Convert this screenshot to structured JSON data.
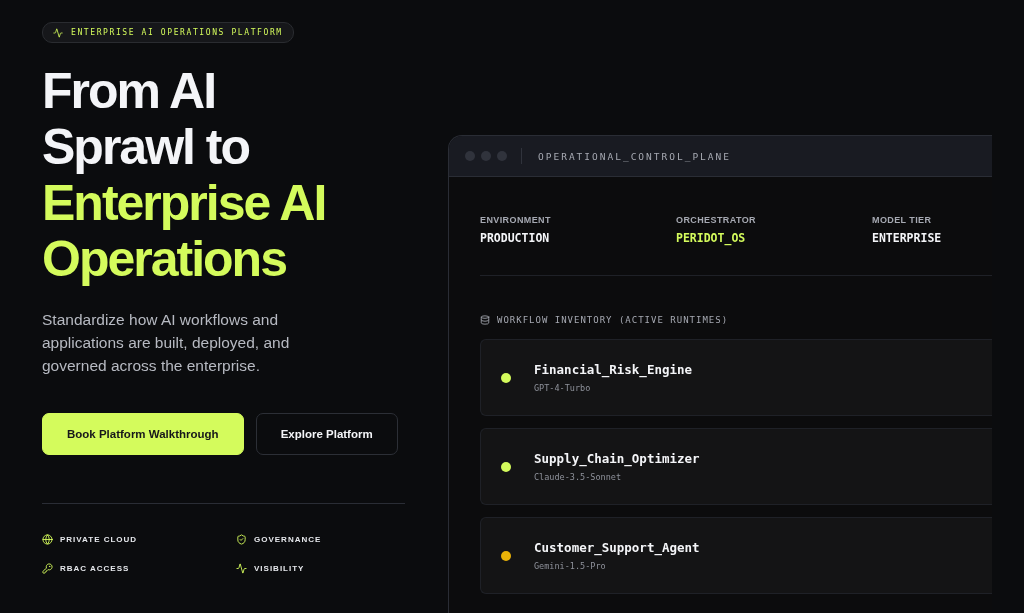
{
  "badge": {
    "text": "ENTERPRISE AI OPERATIONS PLATFORM"
  },
  "headline": {
    "lines": [
      {
        "text": "From AI",
        "accent": false
      },
      {
        "text": "Sprawl to",
        "accent": false
      },
      {
        "text": "Enterprise AI",
        "accent": true
      },
      {
        "text": "Operations",
        "accent": true
      }
    ]
  },
  "description": "Standardize how AI workflows and applications are built, deployed, and governed across the enterprise.",
  "buttons": [
    {
      "label": "Book Platform Walkthrough",
      "kind": "primary"
    },
    {
      "label": "Explore Platform",
      "kind": "secondary"
    }
  ],
  "features": [
    {
      "label": "PRIVATE CLOUD"
    },
    {
      "label": "GOVERNANCE"
    },
    {
      "label": "RBAC ACCESS"
    },
    {
      "label": "VISIBILITY"
    }
  ],
  "panel": {
    "title": "OPERATIONAL_CONTROL_PLANE",
    "meta": [
      {
        "label": "ENVIRONMENT",
        "value": "PRODUCTION",
        "accent": false
      },
      {
        "label": "ORCHESTRATOR",
        "value": "PERIDOT_OS",
        "accent": true
      },
      {
        "label": "MODEL TIER",
        "value": "ENTERPRISE",
        "accent": false
      }
    ],
    "inventory_heading": "WORKFLOW INVENTORY (ACTIVE RUNTIMES)",
    "workflows": [
      {
        "name": "Financial_Risk_Engine",
        "model": "GPT-4-Turbo",
        "color": "#d4fb5c"
      },
      {
        "name": "Supply_Chain_Optimizer",
        "model": "Claude-3.5-Sonnet",
        "color": "#d4fb5c"
      },
      {
        "name": "Customer_Support_Agent",
        "model": "Gemini-1.5-Pro",
        "color": "#eab308"
      }
    ]
  }
}
